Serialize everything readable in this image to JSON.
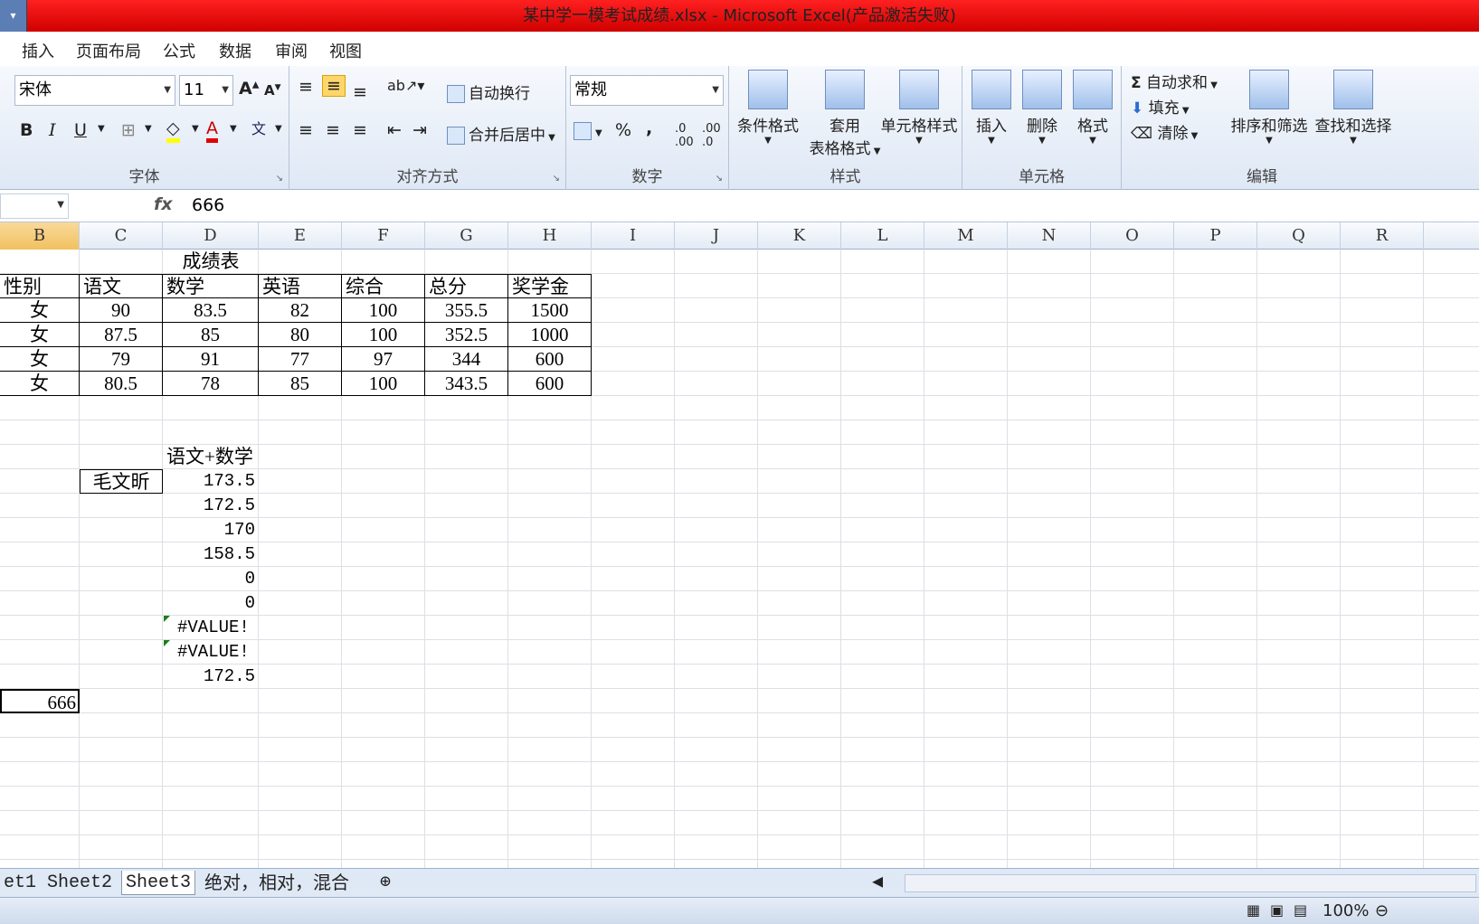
{
  "window": {
    "title": "某中学一模考试成绩.xlsx - Microsoft Excel(产品激活失败)"
  },
  "menu": [
    "插入",
    "页面布局",
    "公式",
    "数据",
    "审阅",
    "视图"
  ],
  "ribbon": {
    "font": {
      "name": "宋体",
      "size": "11",
      "label": "字体"
    },
    "alignment": {
      "wrap": "自动换行",
      "merge": "合并后居中",
      "label": "对齐方式"
    },
    "number": {
      "format": "常规",
      "percent": "%",
      "comma": ",",
      "label": "数字"
    },
    "styles": {
      "conditional": "条件格式",
      "table_a": "套用",
      "table_b": "表格格式",
      "cell_style": "单元格样式",
      "label": "样式"
    },
    "cells": {
      "insert": "插入",
      "delete": "删除",
      "format": "格式",
      "label": "单元格"
    },
    "editing": {
      "autosum": "自动求和",
      "fill": "填充",
      "clear": "清除",
      "sort": "排序和筛选",
      "find": "查找和选择",
      "label": "编辑"
    }
  },
  "formula_bar": {
    "fx": "fx",
    "content": "666"
  },
  "columns": [
    "B",
    "C",
    "D",
    "E",
    "F",
    "G",
    "H",
    "I",
    "J",
    "K",
    "L",
    "M",
    "N",
    "O",
    "P",
    "Q",
    "R"
  ],
  "sheet": {
    "title": "成绩表",
    "headers": [
      "性别",
      "语文",
      "数学",
      "英语",
      "综合",
      "总分",
      "奖学金"
    ],
    "rows": [
      [
        "女",
        "90",
        "83.5",
        "82",
        "100",
        "355.5",
        "1500"
      ],
      [
        "女",
        "87.5",
        "85",
        "80",
        "100",
        "352.5",
        "1000"
      ],
      [
        "女",
        "79",
        "91",
        "77",
        "97",
        "344",
        "600"
      ],
      [
        "女",
        "80.5",
        "78",
        "85",
        "100",
        "343.5",
        "600"
      ]
    ],
    "sum_header": "语文+数学",
    "name_cell": "毛文昕",
    "sum_values": [
      "173.5",
      "172.5",
      "170",
      "158.5",
      "0",
      "0",
      "#VALUE!",
      "#VALUE!",
      "172.5"
    ],
    "active_value": "666"
  },
  "tabs": [
    "et1",
    "Sheet2",
    "Sheet3",
    "绝对，相对，混合"
  ],
  "status": {
    "zoom": "100%"
  }
}
